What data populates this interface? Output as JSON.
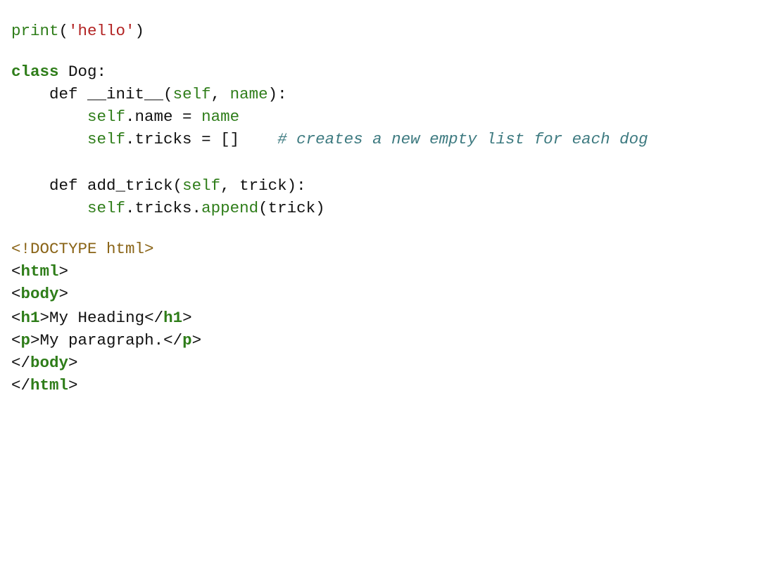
{
  "python_block": {
    "line1": {
      "fn": "print",
      "open": "(",
      "str": "'hello'",
      "close": ")"
    },
    "line2": {
      "kw": "class",
      "rest": " Dog:"
    },
    "line3": {
      "indent": "    ",
      "kw": "def",
      "pre": " __init__(",
      "self": "self",
      "sep": ", ",
      "arg": "name",
      "post": "):"
    },
    "line4": {
      "indent": "        ",
      "self": "self",
      "attr": ".name = ",
      "val": "name"
    },
    "line5": {
      "indent": "        ",
      "self": "self",
      "attr": ".tricks = []",
      "gap": "    ",
      "comment": "# creates a new empty list for each dog"
    },
    "line6": {
      "indent": "    ",
      "kw": "def",
      "pre": " add_trick(",
      "self": "self",
      "sep": ", trick):"
    },
    "line7": {
      "indent": "        ",
      "self": "self",
      "mid": ".tricks.",
      "method": "append",
      "post": "(trick)"
    }
  },
  "html_block": {
    "doctype": "<!DOCTYPE html>",
    "html_open": {
      "lt": "<",
      "tag": "html",
      "gt": ">"
    },
    "body_open": {
      "lt": "<",
      "tag": "body",
      "gt": ">"
    },
    "h1": {
      "lt": "<",
      "tag": "h1",
      "gt": ">",
      "text": "My Heading",
      "lt2": "</",
      "tag2": "h1",
      "gt2": ">"
    },
    "p": {
      "lt": "<",
      "tag": "p",
      "gt": ">",
      "text": "My paragraph.",
      "lt2": "</",
      "tag2": "p",
      "gt2": ">"
    },
    "body_close": {
      "lt": "</",
      "tag": "body",
      "gt": ">"
    },
    "html_close": {
      "lt": "</",
      "tag": "html",
      "gt": ">"
    }
  },
  "colors": {
    "keyword": "#2e7d19",
    "string": "#b22222",
    "comment": "#3d7a80",
    "doctype": "#8a6417",
    "text": "#111111"
  }
}
